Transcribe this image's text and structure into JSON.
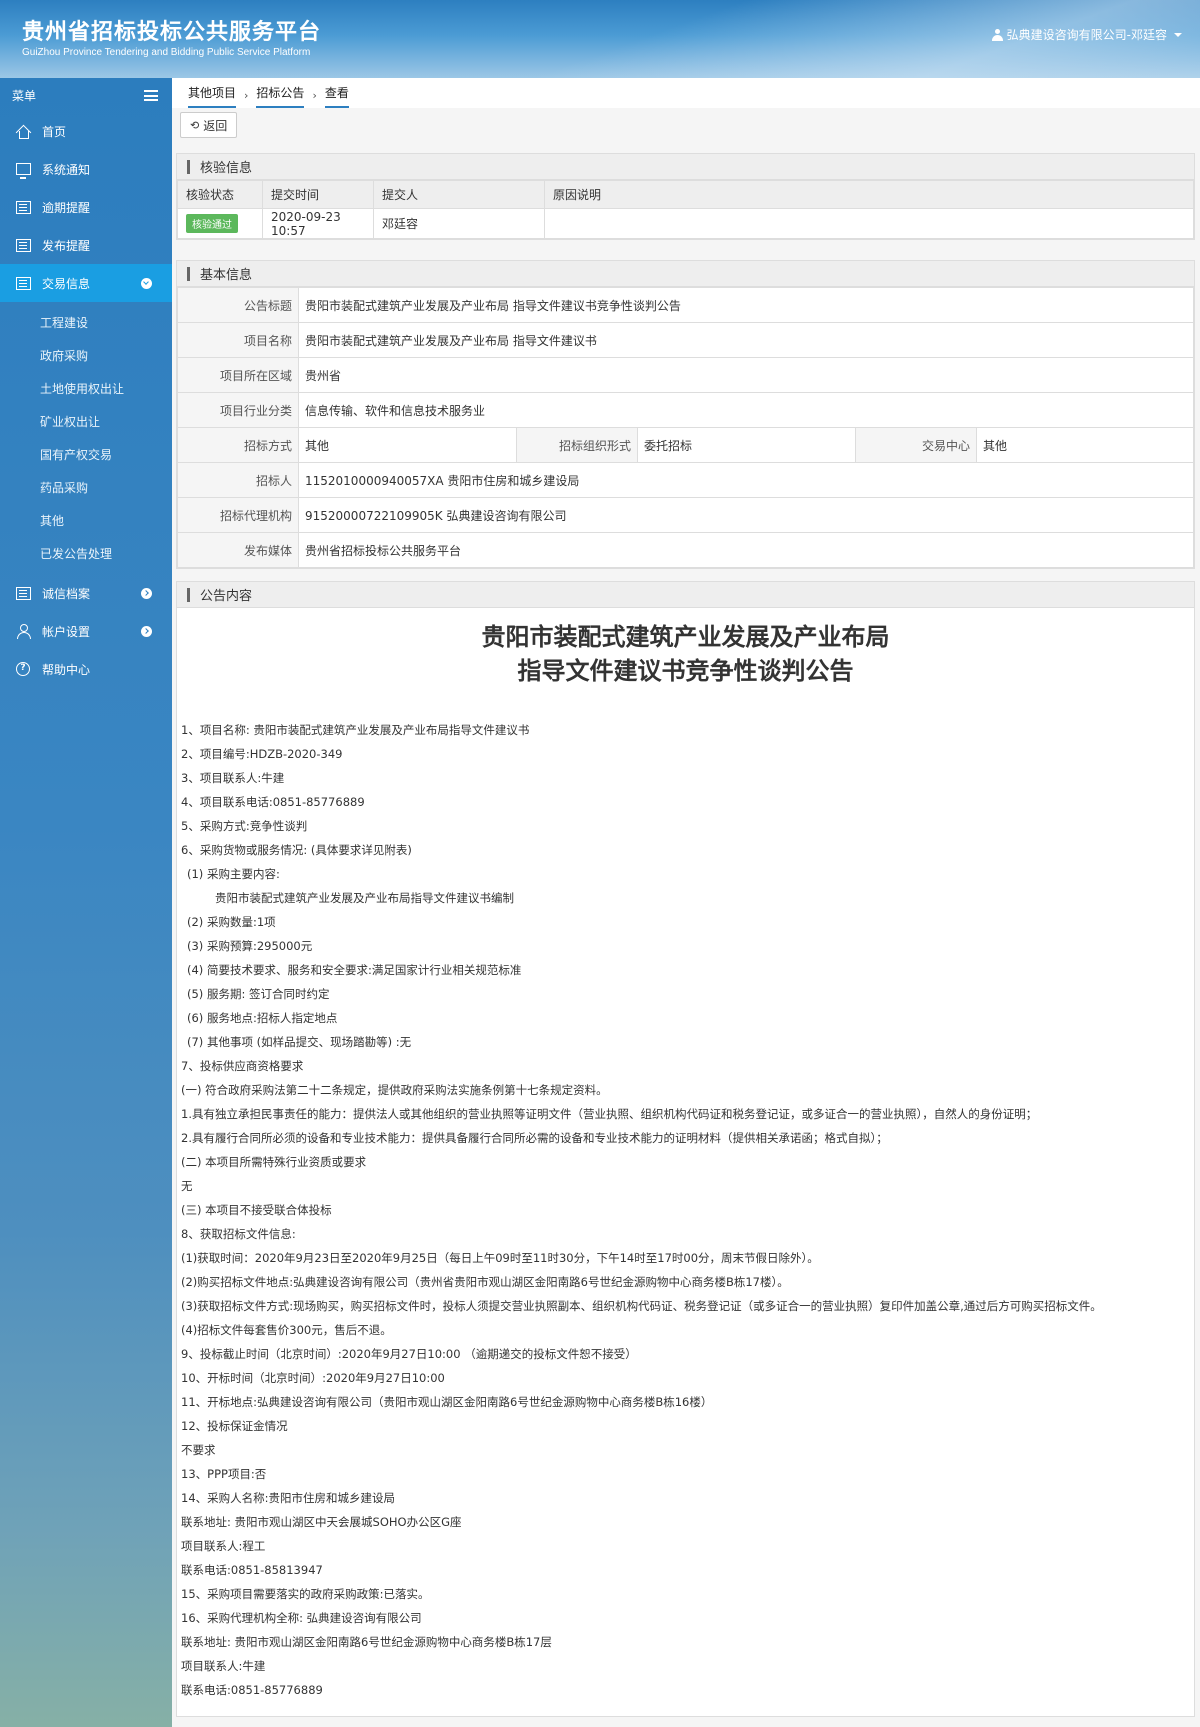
{
  "header": {
    "title_cn": "贵州省招标投标公共服务平台",
    "title_en": "GuiZhou Province Tendering and Bidding Public Service Platform",
    "user": "弘典建设咨询有限公司-邓廷容"
  },
  "sidebar": {
    "menu_label": "菜单",
    "items": [
      {
        "label": "首页"
      },
      {
        "label": "系统通知"
      },
      {
        "label": "逾期提醒"
      },
      {
        "label": "发布提醒"
      },
      {
        "label": "交易信息"
      },
      {
        "label": "诚信档案"
      },
      {
        "label": "帐户设置"
      },
      {
        "label": "帮助中心"
      }
    ],
    "sub_items": [
      "工程建设",
      "政府采购",
      "土地使用权出让",
      "矿业权出让",
      "国有产权交易",
      "药品采购",
      "其他",
      "已发公告处理"
    ]
  },
  "breadcrumb": [
    "其他项目",
    "招标公告",
    "查看"
  ],
  "toolbar": {
    "back_label": "返回"
  },
  "verify": {
    "title": "核验信息",
    "headers": [
      "核验状态",
      "提交时间",
      "提交人",
      "原因说明"
    ],
    "status": "核验通过",
    "time": "2020-09-23 10:57",
    "submitter": "邓廷容",
    "reason": ""
  },
  "basic": {
    "title": "基本信息",
    "announcement_title_label": "公告标题",
    "announcement_title": "贵阳市装配式建筑产业发展及产业布局 指导文件建议书竞争性谈判公告",
    "project_name_label": "项目名称",
    "project_name": "贵阳市装配式建筑产业发展及产业布局 指导文件建议书",
    "region_label": "项目所在区域",
    "region": "贵州省",
    "industry_label": "项目行业分类",
    "industry": "信息传输、软件和信息技术服务业",
    "method_label": "招标方式",
    "method": "其他",
    "org_form_label": "招标组织形式",
    "org_form": "委托招标",
    "center_label": "交易中心",
    "center": "其他",
    "tenderer_label": "招标人",
    "tenderer": "1152010000940057XA 贵阳市住房和城乡建设局",
    "agency_label": "招标代理机构",
    "agency": "91520000722109905K 弘典建设咨询有限公司",
    "media_label": "发布媒体",
    "media": "贵州省招标投标公共服务平台"
  },
  "content": {
    "title": "公告内容",
    "heading_1": "贵阳市装配式建筑产业发展及产业布局",
    "heading_2": "指导文件建议书竞争性谈判公告",
    "lines": [
      "1、项目名称: 贵阳市装配式建筑产业发展及产业布局指导文件建议书",
      "2、项目编号:HDZB-2020-349",
      "3、项目联系人:牛建",
      "4、项目联系电话:0851-85776889",
      "5、采购方式:竞争性谈判",
      "6、采购货物或服务情况: (具体要求详见附表)",
      "(1) 采购主要内容:",
      "贵阳市装配式建筑产业发展及产业布局指导文件建议书编制",
      "(2) 采购数量:1项",
      "(3) 采购预算:295000元",
      "(4) 简要技术要求、服务和安全要求:满足国家计行业相关规范标准",
      "(5) 服务期: 签订合同时约定",
      "(6) 服务地点:招标人指定地点",
      "(7) 其他事项 (如样品提交、现场踏勘等) :无",
      "7、投标供应商资格要求",
      "(一) 符合政府采购法第二十二条规定，提供政府采购法实施条例第十七条规定资料。",
      "1.具有独立承担民事责任的能力：提供法人或其他组织的营业执照等证明文件（营业执照、组织机构代码证和税务登记证，或多证合一的营业执照），自然人的身份证明；",
      "2.具有履行合同所必须的设备和专业技术能力：提供具备履行合同所必需的设备和专业技术能力的证明材料（提供相关承诺函；格式自拟）；",
      "(二) 本项目所需特殊行业资质或要求",
      "无",
      "(三) 本项目不接受联合体投标",
      "8、获取招标文件信息:",
      "(1)获取时间：2020年9月23日至2020年9月25日（每日上午09时至11时30分，下午14时至17时00分，周末节假日除外）。",
      "(2)购买招标文件地点:弘典建设咨询有限公司（贵州省贵阳市观山湖区金阳南路6号世纪金源购物中心商务楼B栋17楼）。",
      "(3)获取招标文件方式:现场购买，购买招标文件时，投标人须提交营业执照副本、组织机构代码证、税务登记证（或多证合一的营业执照）复印件加盖公章,通过后方可购买招标文件。",
      "(4)招标文件每套售价300元，售后不退。",
      "9、投标截止时间（北京时间）:2020年9月27日10:00 （逾期递交的投标文件恕不接受）",
      "10、开标时间（北京时间）:2020年9月27日10:00",
      "11、开标地点:弘典建设咨询有限公司（贵阳市观山湖区金阳南路6号世纪金源购物中心商务楼B栋16楼）",
      "12、投标保证金情况",
      "不要求",
      "13、PPP项目:否",
      "14、采购人名称:贵阳市住房和城乡建设局",
      "联系地址: 贵阳市观山湖区中天会展城SOHO办公区G座",
      "项目联系人:程工",
      "联系电话:0851-85813947",
      "15、采购项目需要落实的政府采购政策:已落实。",
      "16、采购代理机构全称: 弘典建设咨询有限公司",
      "联系地址: 贵阳市观山湖区金阳南路6号世纪金源购物中心商务楼B栋17层",
      "项目联系人:牛建",
      "联系电话:0851-85776889"
    ]
  }
}
